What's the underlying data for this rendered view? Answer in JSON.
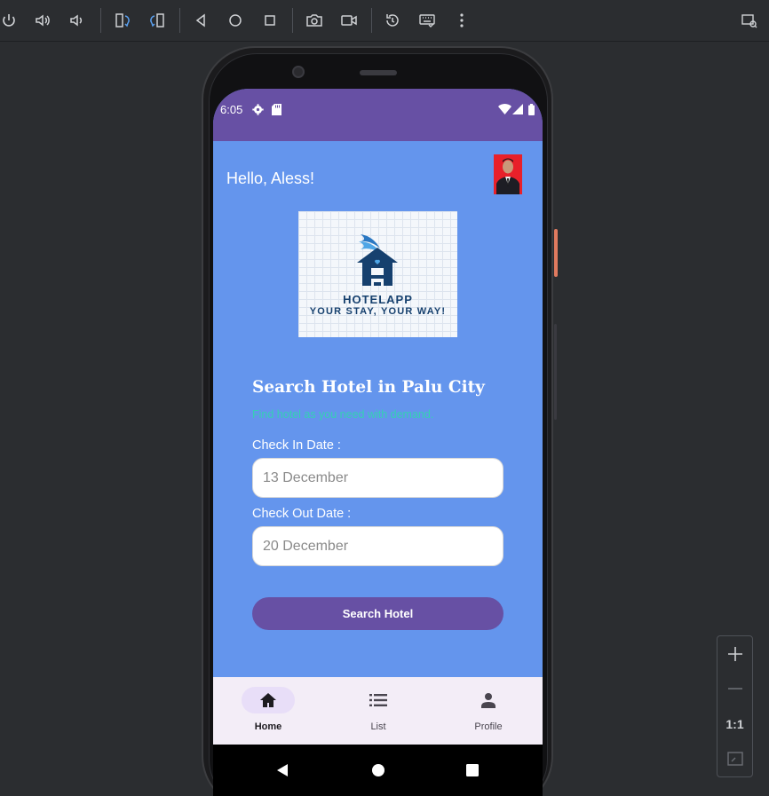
{
  "toolbar": {
    "icons": [
      "power-icon",
      "volume-up-icon",
      "volume-down-icon",
      "rotate-left-icon",
      "rotate-right-icon",
      "back-icon",
      "home-icon",
      "overview-icon",
      "screenshot-icon",
      "screen-record-icon",
      "reset-icon",
      "keyboard-icon",
      "more-icon",
      "device-mirror-icon"
    ]
  },
  "status_bar": {
    "time": "6:05"
  },
  "app": {
    "greeting": "Hello, Aless!",
    "logo": {
      "name": "HOTELAPP",
      "tagline": "YOUR STAY, YOUR WAY!"
    },
    "search": {
      "title": "Search Hotel in Palu City",
      "subtitle": "Find hotel as you need with demand.",
      "check_in_label": "Check In Date :",
      "check_in_value": "13 December",
      "check_out_label": "Check Out Date :",
      "check_out_value": "20 December",
      "button_label": "Search Hotel"
    },
    "nav": [
      {
        "label": "Home",
        "icon": "home-icon",
        "active": true
      },
      {
        "label": "List",
        "icon": "list-icon",
        "active": false
      },
      {
        "label": "Profile",
        "icon": "person-icon",
        "active": false
      }
    ]
  },
  "zoom_panel": {
    "actual_size_label": "1:1"
  },
  "colors": {
    "status_bar": "#6750a4",
    "screen_bg": "#6495ed",
    "button": "#6750a4",
    "subtitle": "#35d0b4",
    "nav_bg": "#f3edf7"
  }
}
